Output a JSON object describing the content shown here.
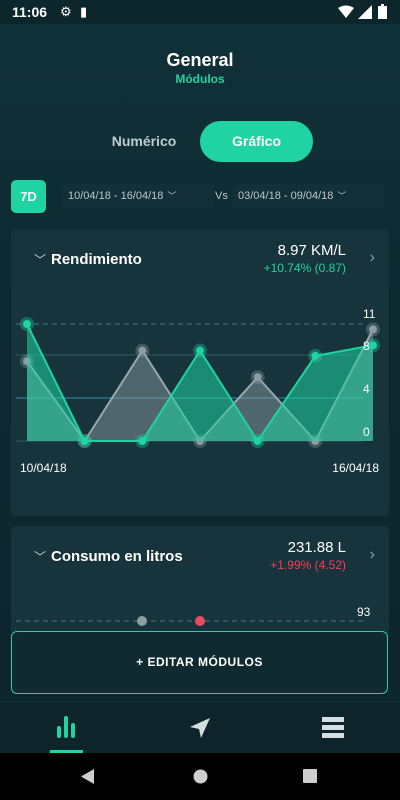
{
  "status_bar": {
    "time": "11:06"
  },
  "header": {
    "title": "General",
    "subtitle": "Módulos"
  },
  "view_toggle": {
    "option_numeric": "Numérico",
    "option_graphic": "Gráfico",
    "selected": "Gráfico"
  },
  "date_range": {
    "badge": "7D",
    "current": "10/04/18 - 16/04/18",
    "vs_label": "Vs",
    "compare": "03/04/18 - 09/04/18"
  },
  "cards": [
    {
      "title": "Rendimiento",
      "value": "8.97 KM/L",
      "change": "+10.74% (0.87)",
      "change_color": "#1fd3a2",
      "start_date": "10/04/18",
      "end_date": "16/04/18"
    },
    {
      "title": "Consumo en litros",
      "value": "231.88 L",
      "change": "+1.99% (4.52)",
      "change_color": "#ff3b55"
    }
  ],
  "chart_data": [
    {
      "type": "area",
      "y_ticks": [
        "11",
        "8",
        "4",
        "0"
      ],
      "ylim": [
        0,
        11
      ],
      "series": [
        {
          "values": [
            11,
            0,
            0,
            8.5,
            0,
            8,
            9
          ]
        },
        {
          "values": [
            7.5,
            0,
            8.5,
            0,
            6,
            0,
            10.5
          ]
        }
      ]
    },
    {
      "type": "area",
      "y_ticks": [
        "93"
      ]
    }
  ],
  "edit_button": {
    "label": "+ EDITAR MÓDULOS"
  },
  "colors": {
    "accent": "#1fd3a2",
    "negative": "#ff3b55",
    "background": "#0f2a31",
    "card": "#17333b"
  },
  "bottom_nav": {
    "items": [
      "chart-icon",
      "navigation-icon",
      "menu-icon"
    ],
    "active": "chart-icon"
  }
}
